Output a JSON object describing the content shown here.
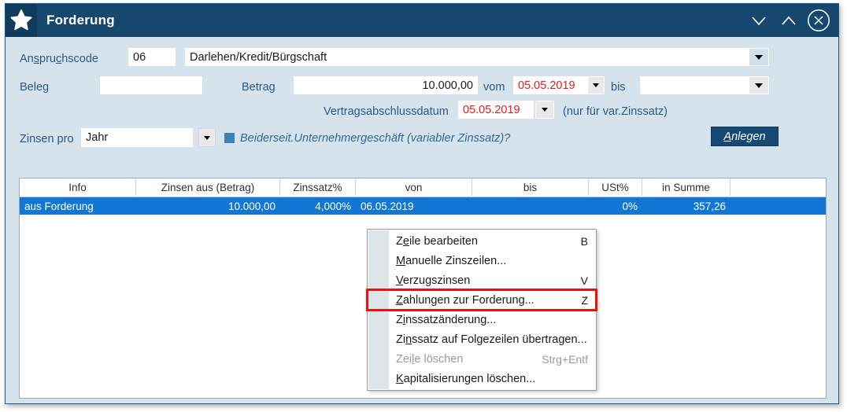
{
  "window": {
    "title": "Forderung",
    "icon": "star-icon",
    "controls": [
      {
        "name": "minimize-button",
        "glyph": "chevron-down-icon"
      },
      {
        "name": "restore-button",
        "glyph": "chevron-up-icon"
      },
      {
        "name": "close-button",
        "glyph": "close-circle-icon"
      }
    ]
  },
  "form": {
    "anspruchscode_label": "Anspruchscode",
    "anspruchscode_value": "06",
    "anspruchscode_text": "Darlehen/Kredit/Bürgschaft",
    "beleg_label": "Beleg",
    "beleg_value": "",
    "betrag_label": "Betrag",
    "betrag_value": "10.000,00",
    "vom_label": "vom",
    "vom_value": "05.05.2019",
    "bis_label": "bis",
    "bis_value": "",
    "vertragsabschlussdatum_label": "Vertragsabschlussdatum",
    "vertragsabschlussdatum_value": "05.05.2019",
    "vertragsabschluss_hint": "(nur für var.Zinssatz)",
    "zinsen_pro_label": "Zinsen pro",
    "zinsen_pro_value": "Jahr",
    "unternehmergeschaeft_label": "Beiderseit.Unternehmergeschäft (variabler Zinssatz)?",
    "anlegen_button": {
      "mnemonic": "A",
      "rest": "nlegen"
    }
  },
  "grid": {
    "columns": [
      "Info",
      "Zinsen aus (Betrag)",
      "Zinssatz%",
      "von",
      "bis",
      "USt%",
      "in Summe"
    ],
    "rows": [
      {
        "info": "aus Forderung",
        "zinsen_aus_betrag": "10.000,00",
        "zinssatz": "4,000%",
        "von": "06.05.2019",
        "bis": "",
        "ust": "0%",
        "in_summe": "357,26"
      }
    ]
  },
  "context_menu": {
    "items": [
      {
        "pre": "Z",
        "mnemonic": "e",
        "post": "ile bearbeiten",
        "shortcut": "B",
        "disabled": false,
        "highlighted": false
      },
      {
        "pre": "",
        "mnemonic": "M",
        "post": "anuelle Zinszeilen...",
        "shortcut": "",
        "disabled": false,
        "highlighted": false
      },
      {
        "pre": "",
        "mnemonic": "V",
        "post": "erzugszinsen",
        "shortcut": "V",
        "disabled": false,
        "highlighted": false
      },
      {
        "pre": "",
        "mnemonic": "Z",
        "post": "ahlungen zur Forderung...",
        "shortcut": "Z",
        "disabled": false,
        "highlighted": true
      },
      {
        "pre": "Z",
        "mnemonic": "i",
        "post": "nssatzänderung...",
        "shortcut": "",
        "disabled": false,
        "highlighted": false
      },
      {
        "pre": "Zi",
        "mnemonic": "n",
        "post": "ssatz auf Folgezeilen übertragen...",
        "shortcut": "",
        "disabled": false,
        "highlighted": false
      },
      {
        "pre": "Zei",
        "mnemonic": "l",
        "post": "e löschen",
        "shortcut": "Strg+Entf",
        "disabled": true,
        "highlighted": false
      },
      {
        "pre": "",
        "mnemonic": "K",
        "post": "apitalisierungen löschen...",
        "shortcut": "",
        "disabled": false,
        "highlighted": false
      }
    ]
  },
  "colors": {
    "titlebar": "#16486f",
    "form_bg": "#d6e3ed",
    "selection": "#1277d4",
    "date_red": "#e8191b",
    "highlight_border": "#f20d0d",
    "accent_blue": "#3b84b0"
  }
}
